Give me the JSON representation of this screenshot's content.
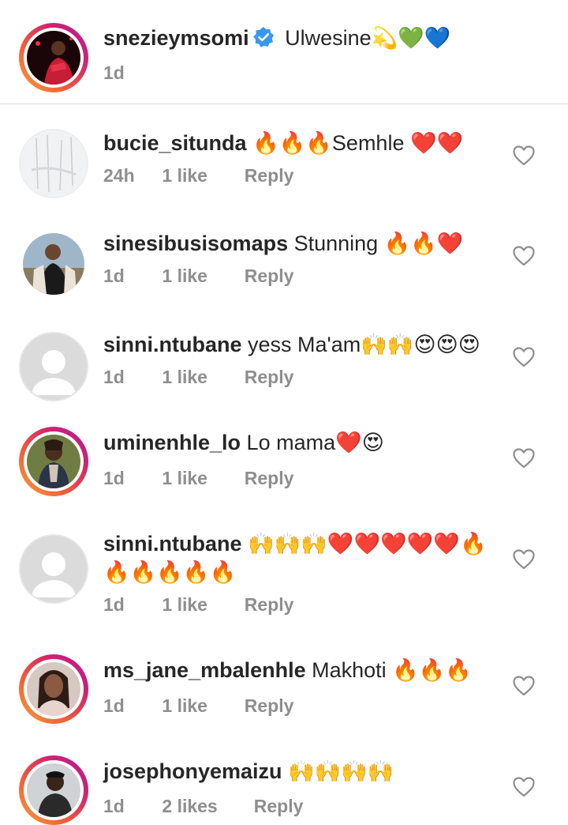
{
  "caption": {
    "username": "snezieymsomi",
    "text": "Ulwesine💫💚💙",
    "time": "1d"
  },
  "comments": [
    {
      "username": "bucie_situnda",
      "text": "🔥🔥🔥Semhle ❤️❤️",
      "time": "24h",
      "likes": "1 like",
      "reply": "Reply"
    },
    {
      "username": "sinesibusisomaps",
      "text": "Stunning 🔥🔥❤️",
      "time": "1d",
      "likes": "1 like",
      "reply": "Reply"
    },
    {
      "username": "sinni.ntubane",
      "text": "yess Ma'am🙌🙌😍😍😍",
      "time": "1d",
      "likes": "1 like",
      "reply": "Reply"
    },
    {
      "username": "uminenhle_lo",
      "text": "Lo mama❤️😍",
      "time": "1d",
      "likes": "1 like",
      "reply": "Reply"
    },
    {
      "username": "sinni.ntubane",
      "text": "🙌🙌🙌❤️❤️❤️❤️❤️🔥🔥🔥🔥🔥🔥",
      "time": "1d",
      "likes": "1 like",
      "reply": "Reply"
    },
    {
      "username": "ms_jane_mbalenhle",
      "text": "Makhoti 🔥🔥🔥",
      "time": "1d",
      "likes": "1 like",
      "reply": "Reply"
    },
    {
      "username": "josephonyemaizu",
      "text": "🙌🙌🙌🙌",
      "time": "1d",
      "likes": "2 likes",
      "reply": "Reply"
    }
  ],
  "icons": {
    "like": "heart-outline-icon",
    "verified": "verified-badge-icon",
    "placeholder_avatar": "default-user-icon"
  },
  "colors": {
    "verified": "#3897f0",
    "meta_text": "#8e8e8e",
    "primary_text": "#262626"
  }
}
